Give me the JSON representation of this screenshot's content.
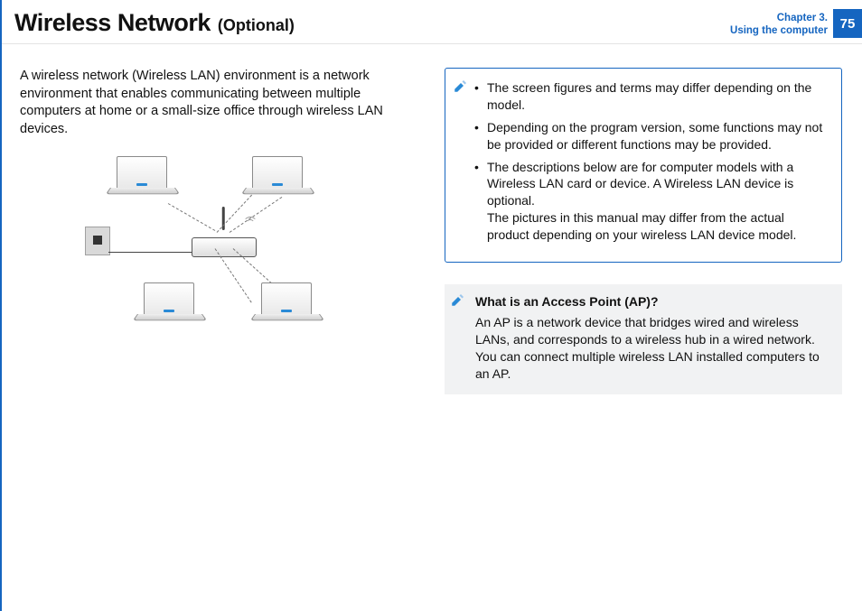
{
  "header": {
    "title": "Wireless Network",
    "subtitle": "(Optional)",
    "chapter_line1": "Chapter 3.",
    "chapter_line2": "Using the computer",
    "page_number": "75"
  },
  "intro": "A wireless network (Wireless LAN) environment is a network environment that enables communicating between multiple computers at home or a small-size office through wireless LAN devices.",
  "notes": {
    "items": [
      {
        "text": "The screen figures and terms may differ depending on the model."
      },
      {
        "text": "Depending on the program version, some functions may not be provided or different functions may be provided."
      },
      {
        "text": "The descriptions below are for computer models with a Wireless LAN card or device. A Wireless LAN device is optional.",
        "sub": "The pictures in this manual may differ from the actual product depending on your wireless LAN device model."
      }
    ]
  },
  "info": {
    "title": "What is an Access Point (AP)?",
    "body": "An AP is a network device that bridges wired and wireless LANs, and corresponds to a wireless hub in a wired network. You can connect multiple wireless LAN installed computers to an AP."
  }
}
